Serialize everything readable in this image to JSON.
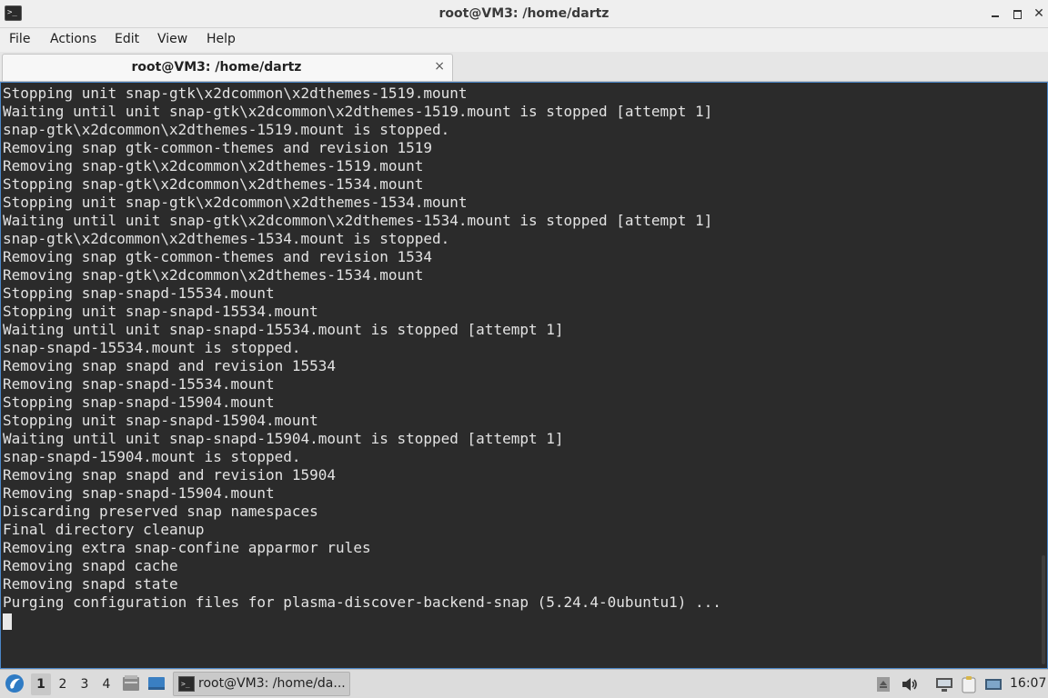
{
  "window": {
    "title": "root@VM3: /home/dartz",
    "app_icon_glyph": ">_"
  },
  "menu": {
    "file": "File",
    "actions": "Actions",
    "edit": "Edit",
    "view": "View",
    "help": "Help"
  },
  "tab": {
    "label": "root@VM3: /home/dartz",
    "close_glyph": "×"
  },
  "terminal": {
    "lines": [
      "Stopping unit snap-gtk\\x2dcommon\\x2dthemes-1519.mount",
      "Waiting until unit snap-gtk\\x2dcommon\\x2dthemes-1519.mount is stopped [attempt 1]",
      "snap-gtk\\x2dcommon\\x2dthemes-1519.mount is stopped.",
      "Removing snap gtk-common-themes and revision 1519",
      "Removing snap-gtk\\x2dcommon\\x2dthemes-1519.mount",
      "Stopping snap-gtk\\x2dcommon\\x2dthemes-1534.mount",
      "Stopping unit snap-gtk\\x2dcommon\\x2dthemes-1534.mount",
      "Waiting until unit snap-gtk\\x2dcommon\\x2dthemes-1534.mount is stopped [attempt 1]",
      "snap-gtk\\x2dcommon\\x2dthemes-1534.mount is stopped.",
      "Removing snap gtk-common-themes and revision 1534",
      "Removing snap-gtk\\x2dcommon\\x2dthemes-1534.mount",
      "Stopping snap-snapd-15534.mount",
      "Stopping unit snap-snapd-15534.mount",
      "Waiting until unit snap-snapd-15534.mount is stopped [attempt 1]",
      "snap-snapd-15534.mount is stopped.",
      "Removing snap snapd and revision 15534",
      "Removing snap-snapd-15534.mount",
      "Stopping snap-snapd-15904.mount",
      "Stopping unit snap-snapd-15904.mount",
      "Waiting until unit snap-snapd-15904.mount is stopped [attempt 1]",
      "snap-snapd-15904.mount is stopped.",
      "Removing snap snapd and revision 15904",
      "Removing snap-snapd-15904.mount",
      "Discarding preserved snap namespaces",
      "Final directory cleanup",
      "Removing extra snap-confine apparmor rules",
      "Removing snapd cache",
      "Removing snapd state",
      "Purging configuration files for plasma-discover-backend-snap (5.24.4-0ubuntu1) ..."
    ]
  },
  "taskbar": {
    "workspaces": [
      "1",
      "2",
      "3",
      "4"
    ],
    "active_workspace": "1",
    "task_label": "root@VM3: /home/da...",
    "clock": "16:07"
  },
  "colors": {
    "terminal_bg": "#2b2b2b",
    "terminal_fg": "#e3e3e3",
    "accent_border": "#4a86c7"
  }
}
